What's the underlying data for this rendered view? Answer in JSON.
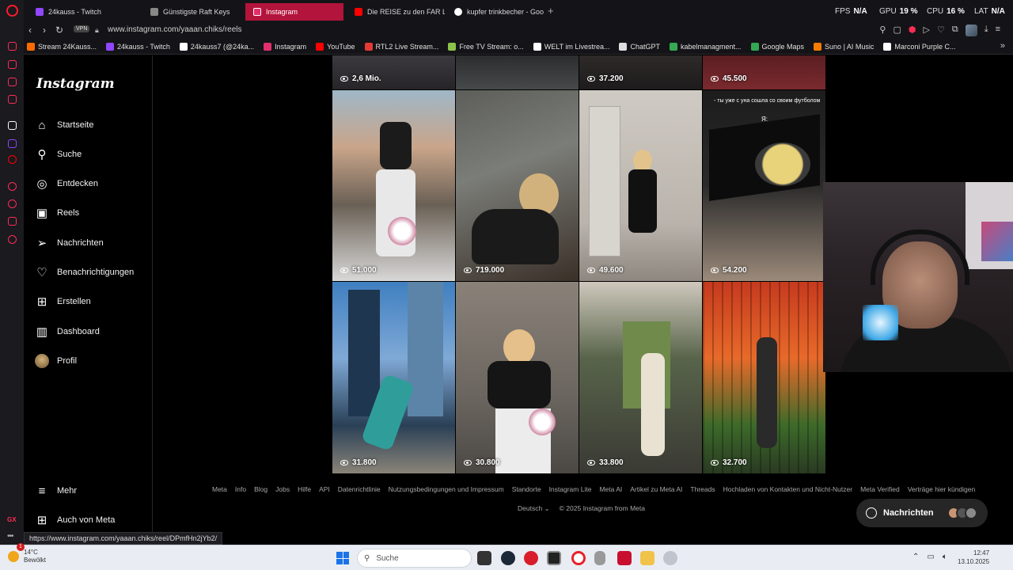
{
  "browser": {
    "tabs": [
      {
        "label": "24kauss - Twitch",
        "color": "#9146ff"
      },
      {
        "label": "Günstigste Raft Keys",
        "color": "#888888"
      },
      {
        "label": "Instagram",
        "color": "#e1306c",
        "active": true
      },
      {
        "label": "Die REISE zu den FAR LA",
        "color": "#ff0000"
      },
      {
        "label": "kupfer trinkbecher - Goo",
        "color": "#4285f4"
      }
    ],
    "hud": {
      "fps_label": "FPS",
      "fps_value": "N/A",
      "gpu_label": "GPU",
      "gpu_value": "19 %",
      "cpu_label": "CPU",
      "cpu_value": "16 %",
      "lat_label": "LAT",
      "lat_value": "N/A"
    },
    "url": "www.instagram.com/yaaan.chiks/reels",
    "vpn_label": "VPN",
    "bookmarks": [
      {
        "label": "Stream 24Kauss...",
        "color": "#ff6a00"
      },
      {
        "label": "24kauss - Twitch",
        "color": "#9146ff"
      },
      {
        "label": "24kauss7 (@24ka...",
        "color": "#ffffff"
      },
      {
        "label": "Instagram",
        "color": "#e1306c"
      },
      {
        "label": "YouTube",
        "color": "#ff0000"
      },
      {
        "label": "RTL2 Live Stream...",
        "color": "#e53935"
      },
      {
        "label": "Free TV Stream: o...",
        "color": "#8bc34a"
      },
      {
        "label": "WELT im Livestrea...",
        "color": "#ffffff"
      },
      {
        "label": "ChatGPT",
        "color": "#dddddd"
      },
      {
        "label": "kabelmanagment...",
        "color": "#34a853"
      },
      {
        "label": "Google Maps",
        "color": "#34a853"
      },
      {
        "label": "Suno | AI Music",
        "color": "#f57c00"
      },
      {
        "label": "Marconi Purple C...",
        "color": "#ffffff"
      }
    ],
    "status_url": "https://www.instagram.com/yaaan.chiks/reel/DPmfHn2jYb2/"
  },
  "instagram": {
    "logo": "Instagram",
    "nav": [
      {
        "label": "Startseite",
        "icon": "home-icon",
        "glyph": "⌂"
      },
      {
        "label": "Suche",
        "icon": "search-icon",
        "glyph": "⚲"
      },
      {
        "label": "Entdecken",
        "icon": "compass-icon",
        "glyph": "◎"
      },
      {
        "label": "Reels",
        "icon": "reels-icon",
        "glyph": "▣"
      },
      {
        "label": "Nachrichten",
        "icon": "messenger-icon",
        "glyph": "➢"
      },
      {
        "label": "Benachrichtigungen",
        "icon": "heart-icon",
        "glyph": "♡"
      },
      {
        "label": "Erstellen",
        "icon": "plus-square-icon",
        "glyph": "⊞"
      },
      {
        "label": "Dashboard",
        "icon": "dashboard-icon",
        "glyph": "▥"
      },
      {
        "label": "Profil",
        "icon": "avatar-icon",
        "glyph": ""
      }
    ],
    "more": "Mehr",
    "also_meta": "Auch von Meta",
    "reels_top": [
      "2,6 Mio.",
      "",
      "37.200",
      "45.500"
    ],
    "reels_mid": [
      "51.000",
      "719.000",
      "49.600",
      "54.200"
    ],
    "reels_bottom": [
      "31.800",
      "30.800",
      "33.800",
      "32.700"
    ],
    "overlay_line1": "- ты уже с уна сошла со своим футболом",
    "overlay_line2": "Я:",
    "footer_links": [
      "Meta",
      "Info",
      "Blog",
      "Jobs",
      "Hilfe",
      "API",
      "Datenrichtlinie",
      "Nutzungsbedingungen und Impressum",
      "Standorte",
      "Instagram Lite",
      "Meta AI",
      "Artikel zu Meta AI",
      "Threads",
      "Hochladen von Kontakten und Nicht-Nutzer",
      "Meta Verified",
      "Verträge hier kündigen"
    ],
    "language": "Deutsch",
    "copyright": "© 2025 Instagram from Meta",
    "messages_pill": "Nachrichten"
  },
  "taskbar": {
    "weather_temp": "14°C",
    "weather_desc": "Bewölkt",
    "notification_count": "1",
    "search_placeholder": "Suche",
    "time": "12:47",
    "date": "13.10.2025"
  }
}
